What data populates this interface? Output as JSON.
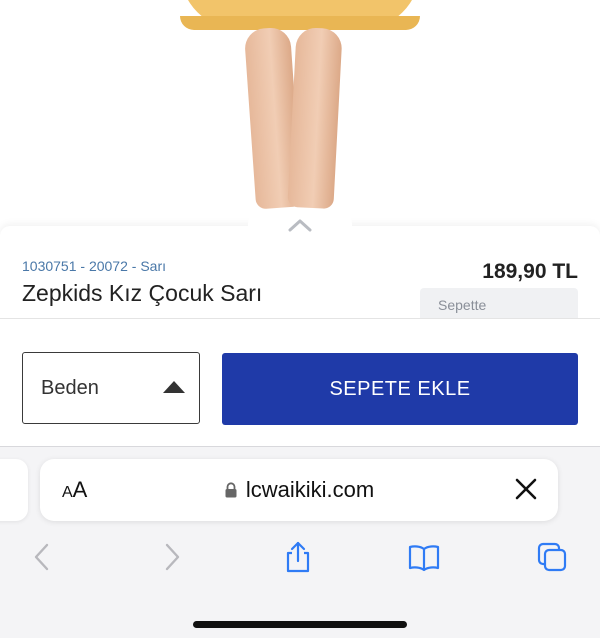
{
  "product": {
    "sku": "1030751 - 20072 - ",
    "color": "Sarı",
    "title": "Zepkids Kız Çocuk Sarı",
    "price": "189,90 TL",
    "cart_status": "Sepette"
  },
  "actions": {
    "size_label": "Beden",
    "add_to_cart_label": "SEPETE EKLE"
  },
  "browser": {
    "text_size_small": "A",
    "text_size_large": "A",
    "domain": "lcwaikiki.com",
    "icons": {
      "back": "chevron-left-icon",
      "forward": "chevron-right-icon",
      "share": "share-icon",
      "bookmarks": "book-icon",
      "tabs": "tabs-icon",
      "close": "close-icon",
      "lock": "lock-icon"
    }
  },
  "colors": {
    "accent_button": "#1f3aa8",
    "link_blue": "#4a78a8",
    "ios_blue": "#2f7bf5",
    "dress_yellow": "#f2c46a"
  }
}
